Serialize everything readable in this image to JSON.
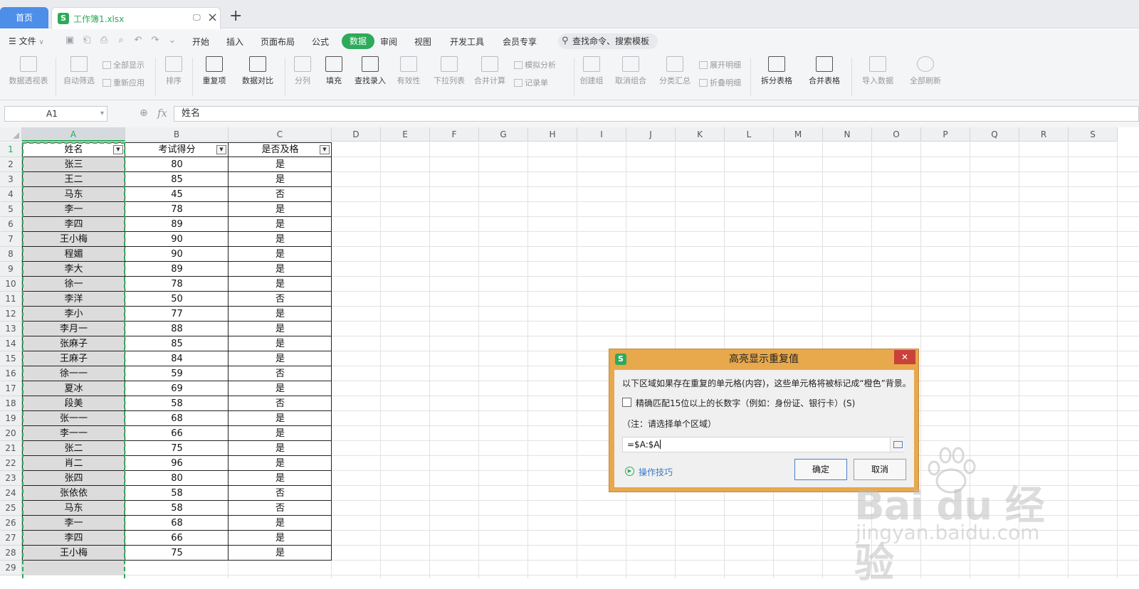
{
  "tabs": {
    "home_label": "首页",
    "file_label": "工作簿1.xlsx",
    "file_logo": "S"
  },
  "menu": {
    "file_label": "文件",
    "items": [
      "开始",
      "插入",
      "页面布局",
      "公式",
      "数据",
      "审阅",
      "视图",
      "开发工具",
      "会员专享"
    ],
    "active_index": 4,
    "search_label": "查找命令、搜索模板"
  },
  "ribbon": {
    "pivot": "数据透视表",
    "autofilter": "自动筛选",
    "show_all": "全部显示",
    "reapply": "重新应用",
    "sort": "排序",
    "duplicates": "重复项",
    "compare": "数据对比",
    "split": "分列",
    "fill": "填充",
    "lookup": "查找录入",
    "validity": "有效性",
    "dropdown": "下拉列表",
    "consolidate": "合并计算",
    "simulate": "模拟分析",
    "record": "记录单",
    "group": "创建组",
    "ungroup": "取消组合",
    "subtotal": "分类汇总",
    "expand": "展开明细",
    "collapse": "折叠明细",
    "split_table": "拆分表格",
    "merge_table": "合并表格",
    "import": "导入数据",
    "refresh": "全部刷新"
  },
  "formula": {
    "name_box": "A1",
    "fx": "fx",
    "content": "姓名"
  },
  "columns": [
    "A",
    "B",
    "C",
    "D",
    "E",
    "F",
    "G",
    "H",
    "I",
    "J",
    "K",
    "L",
    "M",
    "N",
    "O",
    "P",
    "Q",
    "R",
    "S"
  ],
  "rows": [
    "1",
    "2",
    "3",
    "4",
    "5",
    "6",
    "7",
    "8",
    "9",
    "10",
    "11",
    "12",
    "13",
    "14",
    "15",
    "16",
    "17",
    "18",
    "19",
    "20",
    "21",
    "22",
    "23",
    "24",
    "25",
    "26",
    "27",
    "28",
    "29"
  ],
  "table": {
    "headers": [
      "姓名",
      "考试得分",
      "是否及格"
    ],
    "data": [
      [
        "张三",
        "80",
        "是"
      ],
      [
        "王二",
        "85",
        "是"
      ],
      [
        "马东",
        "45",
        "否"
      ],
      [
        "李一",
        "78",
        "是"
      ],
      [
        "李四",
        "89",
        "是"
      ],
      [
        "王小梅",
        "90",
        "是"
      ],
      [
        "程媚",
        "90",
        "是"
      ],
      [
        "李大",
        "89",
        "是"
      ],
      [
        "徐一",
        "78",
        "是"
      ],
      [
        "李洋",
        "50",
        "否"
      ],
      [
        "李小",
        "77",
        "是"
      ],
      [
        "李月一",
        "88",
        "是"
      ],
      [
        "张麻子",
        "85",
        "是"
      ],
      [
        "王麻子",
        "84",
        "是"
      ],
      [
        "徐一一",
        "59",
        "否"
      ],
      [
        "夏冰",
        "69",
        "是"
      ],
      [
        "段美",
        "58",
        "否"
      ],
      [
        "张一一",
        "68",
        "是"
      ],
      [
        "李一一",
        "66",
        "是"
      ],
      [
        "张二",
        "75",
        "是"
      ],
      [
        "肖二",
        "96",
        "是"
      ],
      [
        "张四",
        "80",
        "是"
      ],
      [
        "张依依",
        "58",
        "否"
      ],
      [
        "马东",
        "58",
        "否"
      ],
      [
        "李一",
        "68",
        "是"
      ],
      [
        "李四",
        "66",
        "是"
      ],
      [
        "王小梅",
        "75",
        "是"
      ]
    ]
  },
  "dialog": {
    "logo": "S",
    "title": "高亮显示重复值",
    "close": "✕",
    "description": "以下区域如果存在重复的单元格(内容)，这些单元格将被标记成“橙色”背景。",
    "checkbox_label": "精确匹配15位以上的长数字（例如：身份证、银行卡）(S)",
    "note": "（注：请选择单个区域）",
    "range_value": "=$A:$A",
    "tips": "操作技巧",
    "ok": "确定",
    "cancel": "取消"
  },
  "watermark": {
    "brand": "Bai du 经验",
    "url": "jingyan.baidu.com"
  },
  "colors": {
    "accent": "#2daa5a",
    "home_tab": "#4d8ee8",
    "dialog_frame": "#e8a84c",
    "dialog_close": "#c9413a",
    "selection_bg": "#dcdcdc"
  }
}
